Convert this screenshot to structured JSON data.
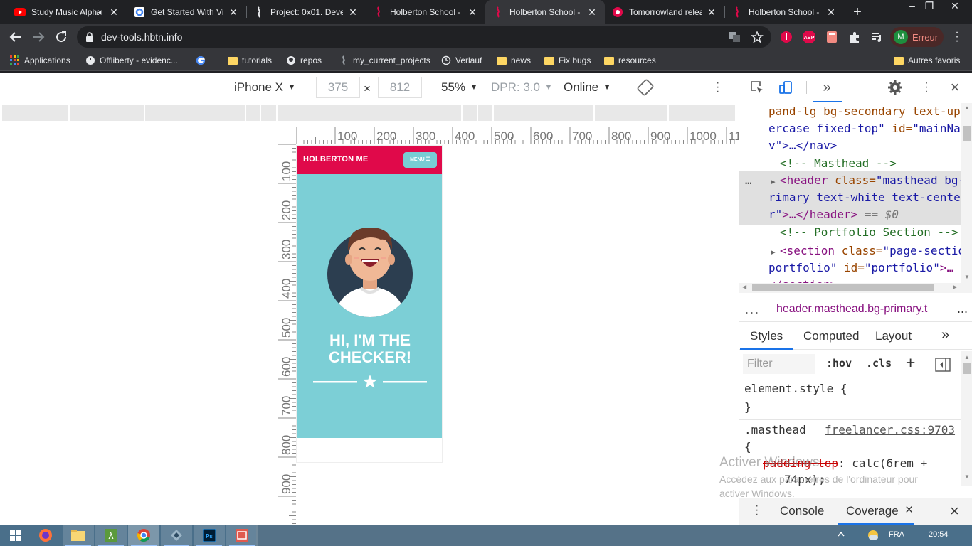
{
  "browser": {
    "tabs": [
      {
        "title": "Study Music Alpha Waves",
        "icon": "youtube-icon",
        "active": false,
        "muted": true
      },
      {
        "title": "Get Started With Vim",
        "icon": "google-docs-icon",
        "active": false
      },
      {
        "title": "Project: 0x01. Develop",
        "icon": "holberton-icon",
        "active": false
      },
      {
        "title": "Holberton School -",
        "icon": "holberton-icon",
        "active": false
      },
      {
        "title": "Holberton School -",
        "icon": "holberton-icon",
        "active": true
      },
      {
        "title": "Tomorrowland release",
        "icon": "holberton-icon",
        "active": false
      },
      {
        "title": "Holberton School -",
        "icon": "holberton-icon",
        "active": false
      }
    ],
    "new_tab": "+",
    "url": "dev-tools.hbtn.info",
    "profile_initial": "M",
    "profile_label": "Erreur",
    "bookmarks": [
      {
        "label": "Applications",
        "icon": "apps-grid-icon"
      },
      {
        "label": "Offliberty - evidenc...",
        "icon": "power-icon"
      },
      {
        "label": "",
        "icon": "google-icon"
      },
      {
        "label": "tutorials",
        "icon": "folder-icon"
      },
      {
        "label": "repos",
        "icon": "github-icon"
      },
      {
        "label": "my_current_projects",
        "icon": "holberton-icon"
      },
      {
        "label": "Verlauf",
        "icon": "history-icon"
      },
      {
        "label": "news",
        "icon": "folder-icon"
      },
      {
        "label": "Fix bugs",
        "icon": "folder-icon"
      },
      {
        "label": "resources",
        "icon": "folder-icon"
      }
    ],
    "other_bookmarks": "Autres favoris"
  },
  "device_toolbar": {
    "device": "iPhone X",
    "width": "375",
    "times": "×",
    "height": "812",
    "zoom": "55%",
    "dpr": "DPR: 3.0",
    "network": "Online"
  },
  "ruler": {
    "top_ticks": [
      "100",
      "200",
      "300",
      "400",
      "500",
      "600",
      "700",
      "800",
      "900",
      "1000",
      "11"
    ],
    "left_ticks": [
      "100",
      "200",
      "300",
      "400",
      "500",
      "600",
      "700",
      "800",
      "900"
    ]
  },
  "page": {
    "brand": "HOLBERTON ME",
    "menu": "MENU",
    "headline_1": "HI, I'M THE",
    "headline_2": "CHECKER!",
    "colors": {
      "nav": "#e0094a",
      "masthead": "#7ccfd6",
      "menu_button": "#78cdd4"
    }
  },
  "devtools": {
    "elements": {
      "l1": "pand-lg bg-secondary text-up",
      "l2a": "ercase fixed-top\"",
      "l2b": " id=",
      "l2c": "\"mainNa",
      "l3": "v\">…</nav>",
      "l4": "<!-- Masthead -->",
      "l5_tag": "<header",
      "l5_attr": " class=",
      "l5_val": "\"masthead bg-p",
      "l6": "rimary text-white text-cente",
      "l7_val": "r\"",
      "l7_tag": ">…</header>",
      "l7_eq": " == $0",
      "l8": "<!-- Portfolio Section -->",
      "l9_tag": "<section",
      "l9_attr": " class=",
      "l9_val": "\"page-sectio",
      "l10_val": "portfolio\"",
      "l10_attr": " id=",
      "l10_val2": "\"portfolio\"",
      "l10_tag": ">…",
      "l11": "</section>",
      "row_menu": "…"
    },
    "breadcrumb_dots": "...",
    "breadcrumb": "header.masthead.bg-primary.t",
    "breadcrumb_more": "...",
    "tabs": [
      "Styles",
      "Computed",
      "Layout",
      "»"
    ],
    "filter_placeholder": "Filter",
    "hov": ":hov",
    "cls": ".cls",
    "plus": "+",
    "rule1": "element.style {",
    "rule1_close": "}",
    "rule2_selector": ".masthead",
    "rule2_source": "freelancer.css:9703",
    "rule2_open": "{",
    "rule2_prop": "padding-top",
    "rule2_value": ": calc(6rem +",
    "rule2_value2": "74px);",
    "watermark_1": "Activer Windows",
    "watermark_2": "Accédez aux paramètres de l'ordinateur pour",
    "watermark_3": "activer Windows.",
    "drawer_tabs": [
      "Console",
      "Coverage"
    ],
    "drawer_close_tab": "×",
    "close": "×"
  },
  "taskbar": {
    "language": "FRA",
    "time": "20:54"
  }
}
